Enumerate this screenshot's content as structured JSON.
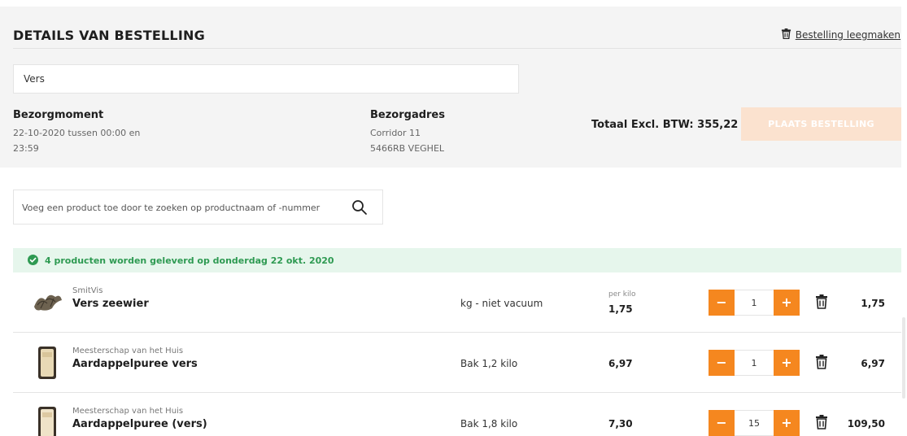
{
  "header": {
    "title": "DETAILS VAN BESTELLING",
    "clear_label": "Bestelling leegmaken"
  },
  "order": {
    "reference_value": "Vers",
    "delivery_moment_label": "Bezorgmoment",
    "delivery_moment_line1": "22-10-2020 tussen 00:00 en",
    "delivery_moment_line2": "23:59",
    "address_label": "Bezorgadres",
    "address_line1": "Corridor 11",
    "address_line2": "5466RB VEGHEL",
    "total_label": "Totaal Excl. BTW: 355,22",
    "place_order_label": "PLAATS BESTELLING"
  },
  "search": {
    "placeholder": "Voeg een product toe door te zoeken op productnaam of -nummer",
    "icon": "search-icon"
  },
  "banner": {
    "text": "4 producten worden geleverd op donderdag 22 okt. 2020",
    "icon": "check-circle-icon",
    "color": "#2e9a52"
  },
  "colors": {
    "accent": "#f5871f",
    "button_disabled": "#fbe2cf"
  },
  "products": [
    {
      "brand": "SmitVis",
      "name": "Vers zeewier",
      "unit": "kg - niet vacuum",
      "per": "per kilo",
      "price": "1,75",
      "quantity": "1",
      "line_total": "1,75",
      "icon": "seaweed-icon"
    },
    {
      "brand": "Meesterschap van het Huis",
      "name": "Aardappelpuree vers",
      "unit": "Bak 1,2 kilo",
      "price": "6,97",
      "quantity": "1",
      "line_total": "6,97",
      "icon": "puree-tub-icon"
    },
    {
      "brand": "Meesterschap van het Huis",
      "name": "Aardappelpuree (vers)",
      "unit": "Bak 1,8 kilo",
      "price": "7,30",
      "quantity": "15",
      "line_total": "109,50",
      "icon": "puree-tub-icon"
    }
  ]
}
